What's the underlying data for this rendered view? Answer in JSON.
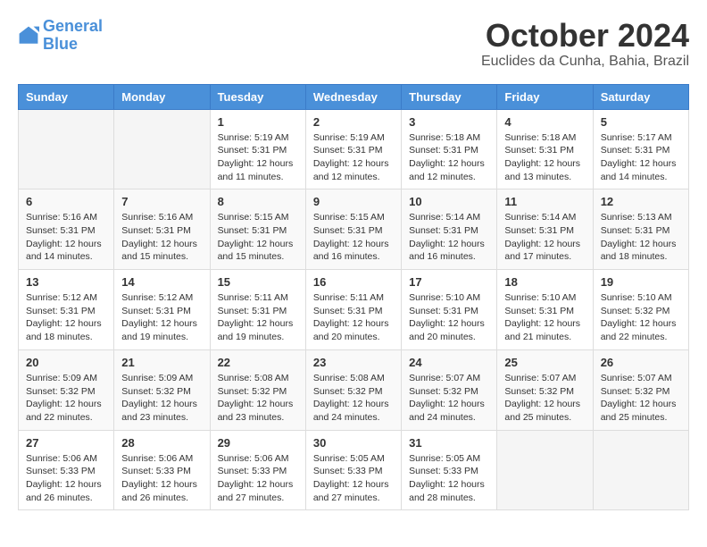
{
  "logo": {
    "line1": "General",
    "line2": "Blue"
  },
  "title": "October 2024",
  "subtitle": "Euclides da Cunha, Bahia, Brazil",
  "days_of_week": [
    "Sunday",
    "Monday",
    "Tuesday",
    "Wednesday",
    "Thursday",
    "Friday",
    "Saturday"
  ],
  "weeks": [
    [
      {
        "day": "",
        "info": ""
      },
      {
        "day": "",
        "info": ""
      },
      {
        "day": "1",
        "info": "Sunrise: 5:19 AM\nSunset: 5:31 PM\nDaylight: 12 hours\nand 11 minutes."
      },
      {
        "day": "2",
        "info": "Sunrise: 5:19 AM\nSunset: 5:31 PM\nDaylight: 12 hours\nand 12 minutes."
      },
      {
        "day": "3",
        "info": "Sunrise: 5:18 AM\nSunset: 5:31 PM\nDaylight: 12 hours\nand 12 minutes."
      },
      {
        "day": "4",
        "info": "Sunrise: 5:18 AM\nSunset: 5:31 PM\nDaylight: 12 hours\nand 13 minutes."
      },
      {
        "day": "5",
        "info": "Sunrise: 5:17 AM\nSunset: 5:31 PM\nDaylight: 12 hours\nand 14 minutes."
      }
    ],
    [
      {
        "day": "6",
        "info": "Sunrise: 5:16 AM\nSunset: 5:31 PM\nDaylight: 12 hours\nand 14 minutes."
      },
      {
        "day": "7",
        "info": "Sunrise: 5:16 AM\nSunset: 5:31 PM\nDaylight: 12 hours\nand 15 minutes."
      },
      {
        "day": "8",
        "info": "Sunrise: 5:15 AM\nSunset: 5:31 PM\nDaylight: 12 hours\nand 15 minutes."
      },
      {
        "day": "9",
        "info": "Sunrise: 5:15 AM\nSunset: 5:31 PM\nDaylight: 12 hours\nand 16 minutes."
      },
      {
        "day": "10",
        "info": "Sunrise: 5:14 AM\nSunset: 5:31 PM\nDaylight: 12 hours\nand 16 minutes."
      },
      {
        "day": "11",
        "info": "Sunrise: 5:14 AM\nSunset: 5:31 PM\nDaylight: 12 hours\nand 17 minutes."
      },
      {
        "day": "12",
        "info": "Sunrise: 5:13 AM\nSunset: 5:31 PM\nDaylight: 12 hours\nand 18 minutes."
      }
    ],
    [
      {
        "day": "13",
        "info": "Sunrise: 5:12 AM\nSunset: 5:31 PM\nDaylight: 12 hours\nand 18 minutes."
      },
      {
        "day": "14",
        "info": "Sunrise: 5:12 AM\nSunset: 5:31 PM\nDaylight: 12 hours\nand 19 minutes."
      },
      {
        "day": "15",
        "info": "Sunrise: 5:11 AM\nSunset: 5:31 PM\nDaylight: 12 hours\nand 19 minutes."
      },
      {
        "day": "16",
        "info": "Sunrise: 5:11 AM\nSunset: 5:31 PM\nDaylight: 12 hours\nand 20 minutes."
      },
      {
        "day": "17",
        "info": "Sunrise: 5:10 AM\nSunset: 5:31 PM\nDaylight: 12 hours\nand 20 minutes."
      },
      {
        "day": "18",
        "info": "Sunrise: 5:10 AM\nSunset: 5:31 PM\nDaylight: 12 hours\nand 21 minutes."
      },
      {
        "day": "19",
        "info": "Sunrise: 5:10 AM\nSunset: 5:32 PM\nDaylight: 12 hours\nand 22 minutes."
      }
    ],
    [
      {
        "day": "20",
        "info": "Sunrise: 5:09 AM\nSunset: 5:32 PM\nDaylight: 12 hours\nand 22 minutes."
      },
      {
        "day": "21",
        "info": "Sunrise: 5:09 AM\nSunset: 5:32 PM\nDaylight: 12 hours\nand 23 minutes."
      },
      {
        "day": "22",
        "info": "Sunrise: 5:08 AM\nSunset: 5:32 PM\nDaylight: 12 hours\nand 23 minutes."
      },
      {
        "day": "23",
        "info": "Sunrise: 5:08 AM\nSunset: 5:32 PM\nDaylight: 12 hours\nand 24 minutes."
      },
      {
        "day": "24",
        "info": "Sunrise: 5:07 AM\nSunset: 5:32 PM\nDaylight: 12 hours\nand 24 minutes."
      },
      {
        "day": "25",
        "info": "Sunrise: 5:07 AM\nSunset: 5:32 PM\nDaylight: 12 hours\nand 25 minutes."
      },
      {
        "day": "26",
        "info": "Sunrise: 5:07 AM\nSunset: 5:32 PM\nDaylight: 12 hours\nand 25 minutes."
      }
    ],
    [
      {
        "day": "27",
        "info": "Sunrise: 5:06 AM\nSunset: 5:33 PM\nDaylight: 12 hours\nand 26 minutes."
      },
      {
        "day": "28",
        "info": "Sunrise: 5:06 AM\nSunset: 5:33 PM\nDaylight: 12 hours\nand 26 minutes."
      },
      {
        "day": "29",
        "info": "Sunrise: 5:06 AM\nSunset: 5:33 PM\nDaylight: 12 hours\nand 27 minutes."
      },
      {
        "day": "30",
        "info": "Sunrise: 5:05 AM\nSunset: 5:33 PM\nDaylight: 12 hours\nand 27 minutes."
      },
      {
        "day": "31",
        "info": "Sunrise: 5:05 AM\nSunset: 5:33 PM\nDaylight: 12 hours\nand 28 minutes."
      },
      {
        "day": "",
        "info": ""
      },
      {
        "day": "",
        "info": ""
      }
    ]
  ]
}
